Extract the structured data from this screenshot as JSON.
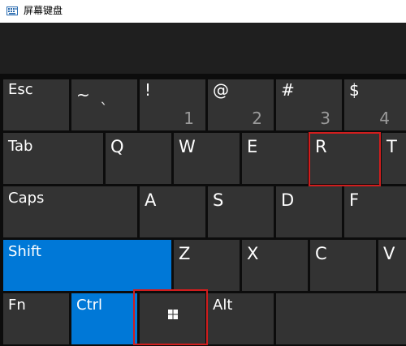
{
  "window": {
    "title": "屏幕键盘"
  },
  "keys": {
    "esc": "Esc",
    "tilde": {
      "shift": "~",
      "base": "`"
    },
    "one": {
      "shift": "!",
      "base": "1"
    },
    "two": {
      "shift": "@",
      "base": "2"
    },
    "three": {
      "shift": "#",
      "base": "3"
    },
    "four": {
      "shift": "$",
      "base": "4"
    },
    "tab": "Tab",
    "q": "Q",
    "w": "W",
    "e": "E",
    "r": "R",
    "t": "T",
    "caps": "Caps",
    "a": "A",
    "s": "S",
    "d": "D",
    "f": "F",
    "shift": "Shift",
    "z": "Z",
    "x": "X",
    "c": "C",
    "v": "V",
    "fn": "Fn",
    "ctrl": "Ctrl",
    "alt": "Alt"
  },
  "colors": {
    "active_key": "#0078d7",
    "key": "#333333",
    "highlight": "#d11d1d"
  },
  "active_keys": [
    "Shift",
    "Ctrl"
  ],
  "highlighted_keys": [
    "R",
    "Windows"
  ]
}
